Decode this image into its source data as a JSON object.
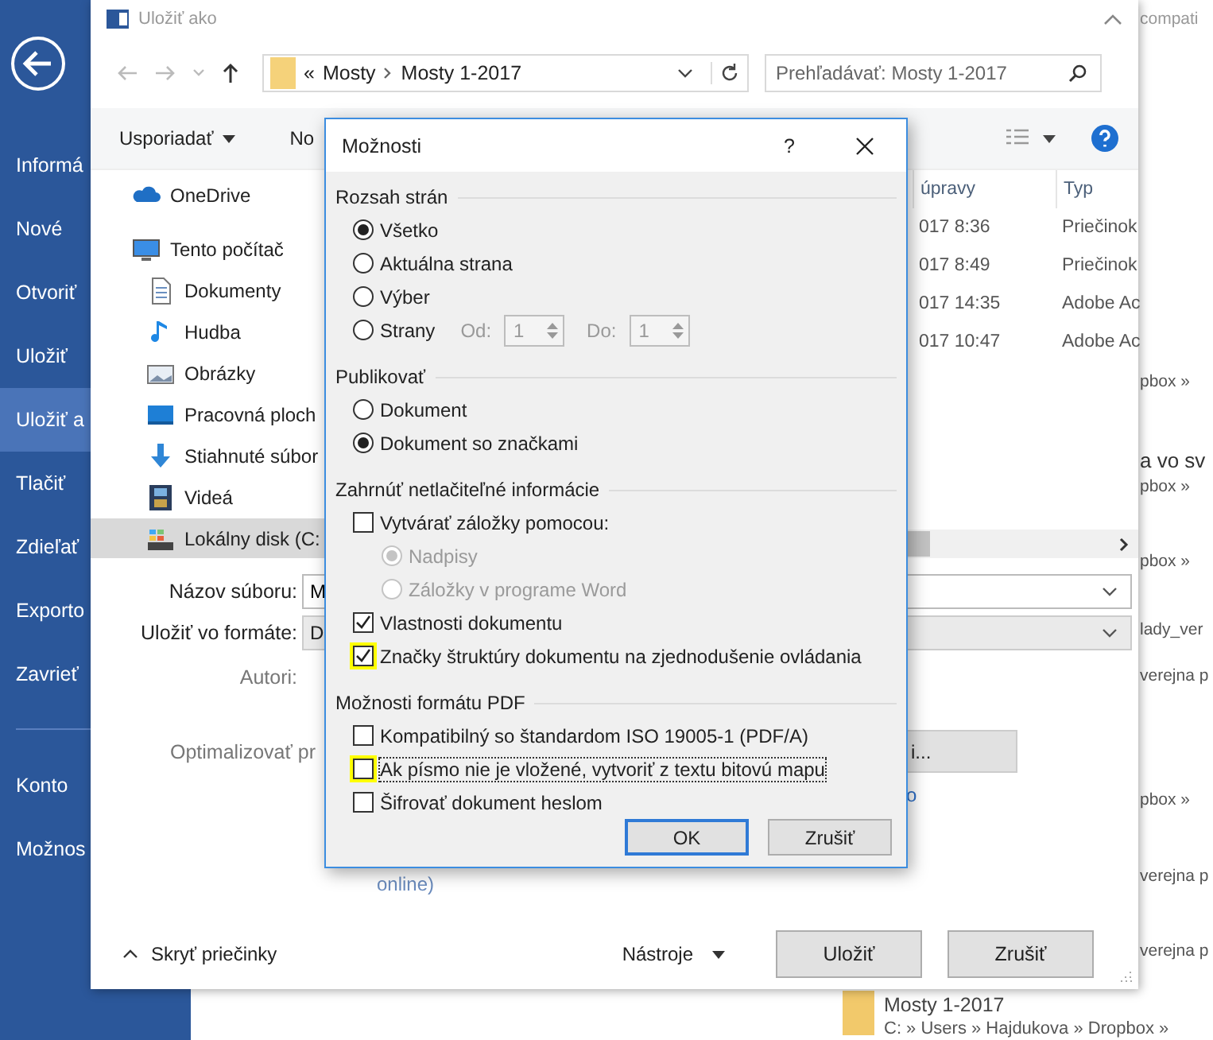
{
  "backstage": {
    "nav_main": [
      {
        "label": "Informá",
        "selected": false
      },
      {
        "label": "Nové",
        "selected": false
      },
      {
        "label": "Otvoriť",
        "selected": false
      },
      {
        "label": "Uložiť",
        "selected": false
      },
      {
        "label": "Uložiť a",
        "selected": true
      },
      {
        "label": "Tlačiť",
        "selected": false
      },
      {
        "label": "Zdieľať",
        "selected": false
      },
      {
        "label": "Exporto",
        "selected": false
      },
      {
        "label": "Zavrieť",
        "selected": false
      }
    ],
    "nav_bottom": [
      {
        "label": "Konto",
        "selected": false
      },
      {
        "label": "Možnos",
        "selected": false
      }
    ],
    "recent_lines": [
      {
        "kind": "path",
        "text": "compati"
      },
      {
        "kind": "path",
        "text": "pbox »"
      },
      {
        "kind": "title",
        "text": "a vo sv"
      },
      {
        "kind": "path",
        "text": "pbox »"
      },
      {
        "kind": "path",
        "text": "pbox »"
      },
      {
        "kind": "path",
        "text": "lady_ver"
      },
      {
        "kind": "path",
        "text": "verejna p"
      },
      {
        "kind": "path",
        "text": "pbox »"
      },
      {
        "kind": "path",
        "text": "verejna p"
      },
      {
        "kind": "path",
        "text": "verejna p"
      }
    ],
    "bottom_folder": {
      "title": "Mosty 1-2017",
      "path": "C: » Users » Hajdukova » Dropbox »"
    }
  },
  "save_dialog": {
    "title": "Uložiť ako",
    "address": {
      "prefix": "«",
      "segments": [
        "Mosty",
        "Mosty 1-2017"
      ]
    },
    "search": {
      "placeholder": "Prehľadávať: Mosty 1-2017"
    },
    "toolbar": {
      "organize": "Usporiadať",
      "new_folder": "No"
    },
    "nav_pane": [
      {
        "kind": "cloud",
        "label": "OneDrive",
        "selected": false
      },
      {
        "kind": "pc",
        "label": "Tento počítač",
        "selected": false,
        "children": [
          {
            "kind": "documents",
            "label": "Dokumenty",
            "selected": false
          },
          {
            "kind": "music",
            "label": "Hudba",
            "selected": false
          },
          {
            "kind": "pictures",
            "label": "Obrázky",
            "selected": false
          },
          {
            "kind": "desktop",
            "label": "Pracovná ploch",
            "selected": false
          },
          {
            "kind": "downloads",
            "label": "Stiahnuté súbor",
            "selected": false
          },
          {
            "kind": "videos",
            "label": "Videá",
            "selected": false
          },
          {
            "kind": "disk",
            "label": "Lokálny disk (C:",
            "selected": true
          }
        ]
      }
    ],
    "file_list": {
      "columns": [
        "úpravy",
        "Typ"
      ],
      "rows": [
        [
          "017 8:36",
          "Priečinok"
        ],
        [
          "017 8:49",
          "Priečinok"
        ],
        [
          "017 14:35",
          "Adobe Ac"
        ],
        [
          "017 10:47",
          "Adobe Ac"
        ]
      ]
    },
    "form": {
      "file_name": {
        "label": "Názov súboru:",
        "value": "M"
      },
      "format": {
        "label": "Uložiť vo formáte:",
        "value": "D"
      },
      "authors_label": "Autori:",
      "optimize_label": "Optimalizovať pr",
      "options_button": "i...",
      "link": "o",
      "online_text": "online)"
    },
    "hide_folders": "Skryť priečinky",
    "tools": "Nástroje",
    "buttons": [
      "Uložiť",
      "Zrušiť"
    ]
  },
  "options_dialog": {
    "title": "Možnosti",
    "help": "?",
    "groups": [
      {
        "title": "Rozsah strán",
        "items": [
          {
            "kind": "radio",
            "label": "Všetko",
            "selected": true,
            "disabled": false
          },
          {
            "kind": "radio",
            "label": "Aktuálna strana",
            "selected": false,
            "disabled": false
          },
          {
            "kind": "radio",
            "label": "Výber",
            "selected": false,
            "disabled": false
          },
          {
            "kind": "range",
            "label": "Strany",
            "selected": false,
            "disabled": false,
            "from_label": "Od:",
            "from_value": "1",
            "to_label": "Do:",
            "to_value": "1"
          }
        ]
      },
      {
        "title": "Publikovať",
        "items": [
          {
            "kind": "radio",
            "label": "Dokument",
            "selected": false,
            "disabled": false
          },
          {
            "kind": "radio",
            "label": "Dokument so značkami",
            "selected": true,
            "disabled": false
          }
        ]
      },
      {
        "title": "Zahrnúť netlačiteľné informácie",
        "items": [
          {
            "kind": "checkbox",
            "label": "Vytvárať záložky pomocou:",
            "checked": false,
            "highlighted": false,
            "focused": false,
            "children": [
              {
                "kind": "radio",
                "label": "Nadpisy",
                "selected": true,
                "disabled": true
              },
              {
                "kind": "radio",
                "label": "Záložky v programe Word",
                "selected": false,
                "disabled": true
              }
            ]
          },
          {
            "kind": "checkbox",
            "label": "Vlastnosti dokumentu",
            "checked": true,
            "highlighted": false,
            "focused": false
          },
          {
            "kind": "checkbox",
            "label": "Značky štruktúry dokumentu na zjednodušenie ovládania",
            "checked": true,
            "highlighted": true,
            "focused": false
          }
        ]
      },
      {
        "title": "Možnosti formátu PDF",
        "items": [
          {
            "kind": "checkbox",
            "label": "Kompatibilný so štandardom ISO 19005-1 (PDF/A)",
            "checked": false,
            "highlighted": false,
            "focused": false
          },
          {
            "kind": "checkbox",
            "label": "Ak písmo nie je vložené, vytvoriť z textu bitovú mapu",
            "checked": false,
            "highlighted": true,
            "focused": true
          },
          {
            "kind": "checkbox",
            "label": "Šifrovať dokument heslom",
            "checked": false,
            "highlighted": false,
            "focused": false
          }
        ]
      }
    ],
    "buttons": [
      {
        "label": "OK",
        "default": true
      },
      {
        "label": "Zrušiť",
        "default": false
      }
    ]
  }
}
